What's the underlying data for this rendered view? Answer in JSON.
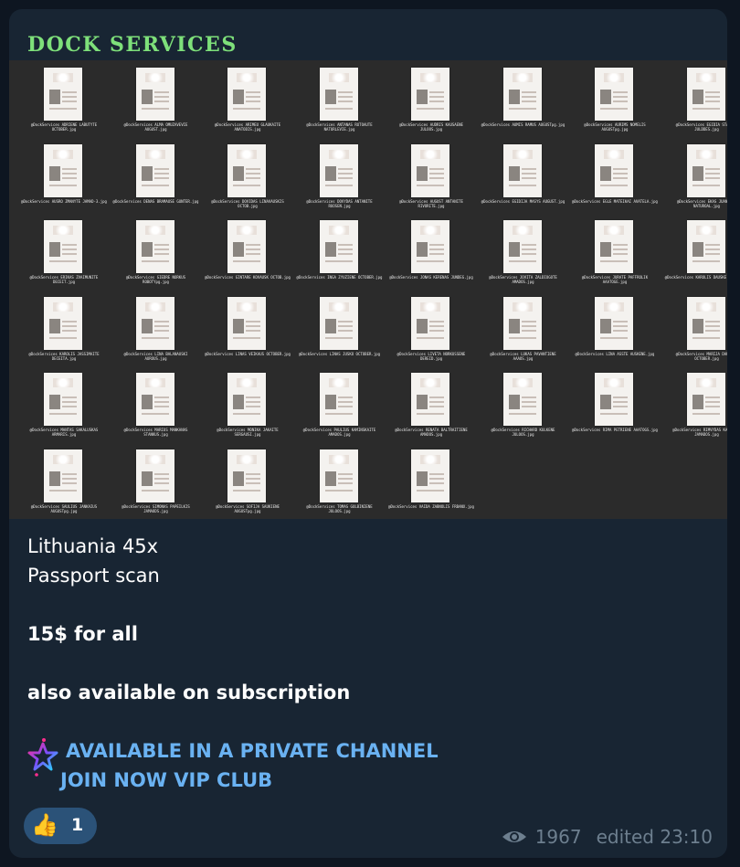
{
  "channel": {
    "name": "DOCK SERVICES",
    "name_color": "#7ee07a"
  },
  "media": {
    "thumbnails": [
      "@DockServices ADRIENE LABUTYTE OCTOBER.jpg",
      "@DockServices ALMA OMUZAVEVIE AUGUST.jpg",
      "@DockServices ARIMEU GLAUKAITE ANATODIS.jpg",
      "@DockServices ANTANAS RUTOAUTE NATURLEVIE.jpg",
      "@DockServices AUDRIS KAUSAENE JULOOS.jpg",
      "@DockServices AUMIS RAMUS AUGUSTpg.jpg",
      "@DockServices AURIMS NOMELIS AUGUSTpg.jpg",
      "@DockServices EGIDIA STANKUS JULDDES.jpg",
      "@DockServices AUSRO ZMANYTE JAMAD-3.jpg",
      "@DockServices DENAS BRAMAUSE GUNTER.jpg",
      "@DockServices DOVIDAS LINAVAUSKIS OCTOB.jpg",
      "@DockServices DOVYDAS ANTANITE RUOSEN.jpg",
      "@DockServices AUGUST ANTANITE RIVORITE.jpg",
      "@DockServices EGIDIJA MASYS AUGUST.jpg",
      "@DockServices EGLE MATEIKAI AVATELA.jpg",
      "@DockServices EKAS JUANAVIS NATUROAL.jpg",
      "@DockServices ERIKAS ZVAIMUNITE DECEIT.jpg",
      "@DockServices GIEDRE NORKUS ROBOTYpg.jpg",
      "@DockServices GINTARE KOVAUSK OCTOB.jpg",
      "@DockServices INGA ZYUZIENE OCTOBER.jpg",
      "@DockServices JONAS KERENAS JUNDEG.jpg",
      "@DockServices JOVITA ZALDIOGOTE AMADOS.jpg",
      "@DockServices JURATE PAFFROLIK AAATOGE.jpg",
      "@DockServices KAROLIS DAUSKE OCTOB.jpg",
      "@DockServices KAROLIS JASSIMAITE DECEITA.jpg",
      "@DockServices LINA BALANAUSKI AUROUS.jpg",
      "@DockServices LINAS VEIKAUS OCTOBER.jpg",
      "@DockServices LINAS JUSKO OCTOBER.jpg",
      "@DockServices LIVETA NORKUSSENE DEREID.jpg",
      "@DockServices LUKAS PAVANTIENE AAAOS.jpg",
      "@DockServices LINA ASSTE AUSKENE.jpg",
      "@DockServices MARIJA DAUSENA OCTOBER.jpg",
      "@DockServices MANTAS SAKALUSKAS ARMARIS.jpg",
      "@DockServices MARIUS MANKANAS STANKUS.jpg",
      "@DockServices MONIKA JAKAITE SERGAUSI.jpg",
      "@DockServices PAULIUS KAMINSKAITE AMADOS.jpg",
      "@DockServices RENATA BALTRAITIENE AMADOS.jpg",
      "@DockServices RICHARD KULKENE JULOOS.jpg",
      "@DockServices RIMA PETRIENE AAATOGS.jpg",
      "@DockServices RIMVYDAS KAVARINE JAMADOS.jpg",
      "@DockServices SAULIUS JANKAIUS AUGUSTpg.jpg",
      "@DockServices SIMONAS PAPEILKIS JAMAODS.jpg",
      "@DockServices SOFIJA SAUKIENE AUGUSTpg.jpg",
      "@DockServices TOMAS GULBINIENE JULOOS.jpg",
      "@DockServices VAIDA ZABNOLIS FRBANX.jpg"
    ]
  },
  "message": {
    "line1": "Lithuania 45x",
    "line2": "Passport scan",
    "price": "15$ for all",
    "subscription": "also available on subscription",
    "link1": "AVAILABLE IN A PRIVATE CHANNEL",
    "link2": "JOIN NOW VIP CLUB"
  },
  "reaction": {
    "emoji": "👍",
    "count": "1"
  },
  "meta": {
    "views": "1967",
    "edited": "edited 23:10"
  },
  "colors": {
    "background": "#0e1621",
    "bubble": "#182533",
    "link": "#6ab2f2",
    "reaction_bg": "#2b5278",
    "meta": "#6d7f8f"
  },
  "icons": [
    "star-icon",
    "eye-icon",
    "thumbs-up-icon"
  ]
}
